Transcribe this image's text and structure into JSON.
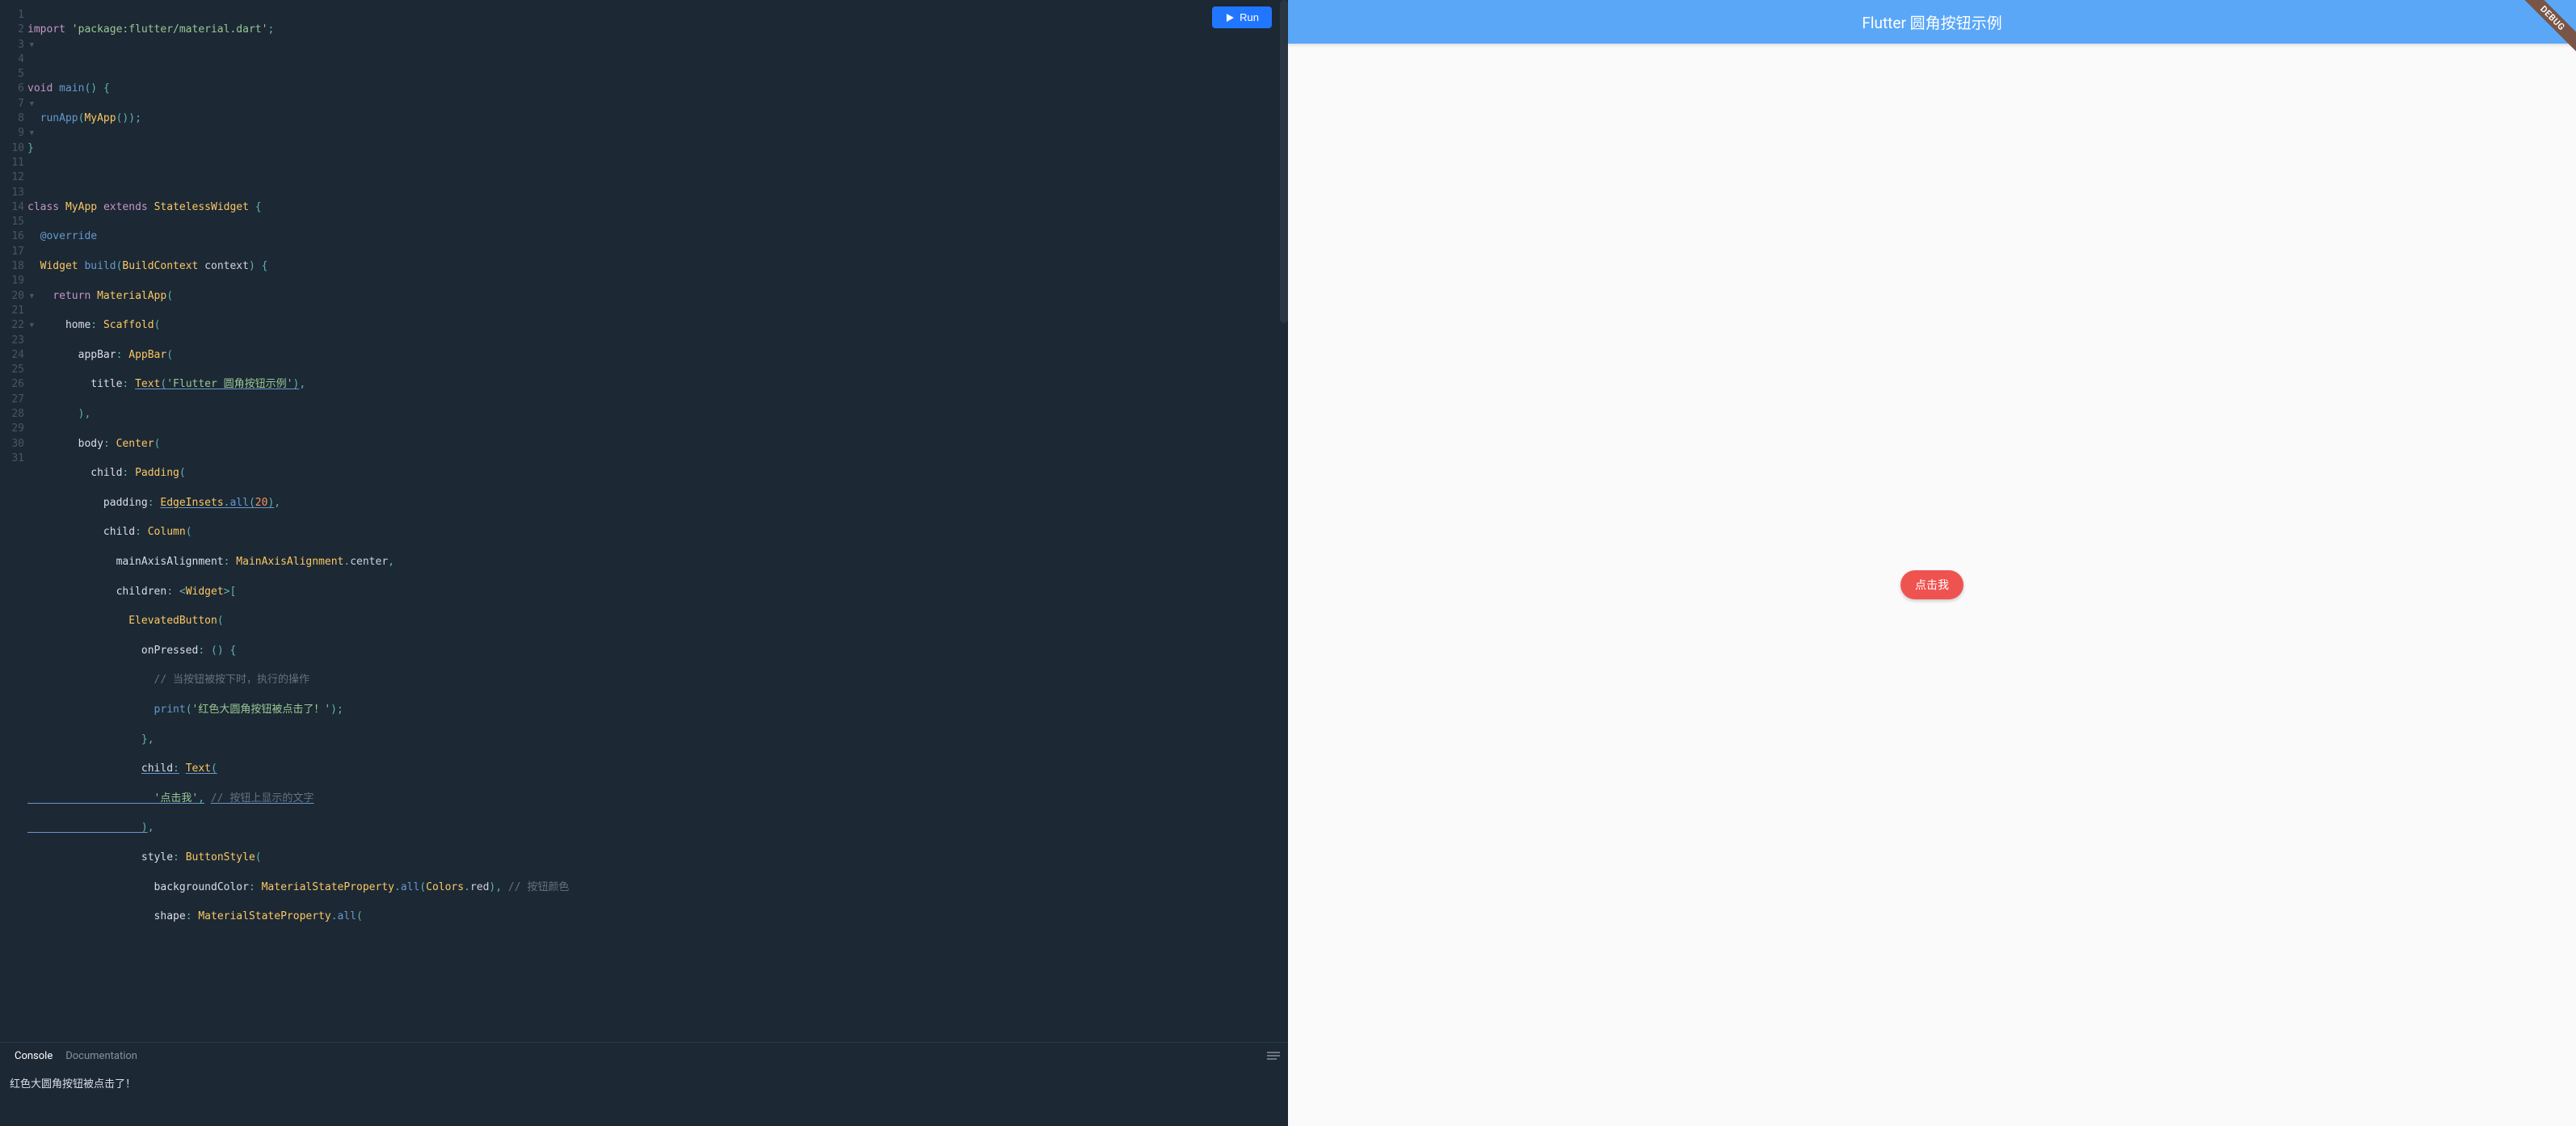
{
  "run_button_label": "Run",
  "gutter": {
    "lines": [
      "1",
      "2",
      "3",
      "4",
      "5",
      "6",
      "7",
      "8",
      "9",
      "10",
      "11",
      "12",
      "13",
      "14",
      "15",
      "16",
      "17",
      "18",
      "19",
      "20",
      "21",
      "22",
      "23",
      "24",
      "25",
      "26",
      "27",
      "28",
      "29",
      "30",
      "31"
    ],
    "folds": {
      "3": true,
      "7": true,
      "9": true,
      "20": true,
      "22": true
    }
  },
  "code_tokens": {
    "l1_import": "import",
    "l1_pkg": "'package:flutter/material.dart'",
    "l3_void": "void",
    "l3_main": "main",
    "l4_runApp": "runApp",
    "l4_MyApp": "MyApp",
    "l7_class": "class",
    "l7_MyApp": "MyApp",
    "l7_extends": "extends",
    "l7_StatelessWidget": "StatelessWidget",
    "l8_override": "@override",
    "l9_Widget": "Widget",
    "l9_build": "build",
    "l9_BuildContext": "BuildContext",
    "l9_context": "context",
    "l10_return": "return",
    "l10_MaterialApp": "MaterialApp",
    "l11_home": "home",
    "l11_Scaffold": "Scaffold",
    "l12_appBar": "appBar",
    "l12_AppBar": "AppBar",
    "l13_title": "title",
    "l13_Text": "Text",
    "l13_str": "'Flutter 圆角按钮示例'",
    "l15_body": "body",
    "l15_Center": "Center",
    "l16_child": "child",
    "l16_Padding": "Padding",
    "l17_padding": "padding",
    "l17_EdgeInsets": "EdgeInsets",
    "l17_all": "all",
    "l17_20": "20",
    "l18_child": "child",
    "l18_Column": "Column",
    "l19_mainAxisAlignment": "mainAxisAlignment",
    "l19_MainAxisAlignment": "MainAxisAlignment",
    "l19_center": "center",
    "l20_children": "children",
    "l20_Widget": "Widget",
    "l21_ElevatedButton": "ElevatedButton",
    "l22_onPressed": "onPressed",
    "l23_cmt": "// 当按钮被按下时，执行的操作",
    "l24_print": "print",
    "l24_str": "'红色大圆角按钮被点击了！'",
    "l26_child": "child",
    "l26_Text": "Text",
    "l27_str": "'点击我'",
    "l27_cmt": "// 按钮上显示的文字",
    "l29_style": "style",
    "l29_ButtonStyle": "ButtonStyle",
    "l30_backgroundColor": "backgroundColor",
    "l30_MaterialStateProperty": "MaterialStateProperty",
    "l30_all": "all",
    "l30_Colors": "Colors",
    "l30_red": "red",
    "l30_cmt": "// 按钮颜色",
    "l31_shape": "shape",
    "l31_MaterialStateProperty": "MaterialStateProperty",
    "l31_all": "all"
  },
  "tabs": {
    "console": "Console",
    "documentation": "Documentation"
  },
  "console_output": "红色大圆角按钮被点击了！",
  "preview": {
    "appbar_title": "Flutter 圆角按钮示例",
    "button_label": "点击我",
    "debug_banner": "DEBUG"
  }
}
